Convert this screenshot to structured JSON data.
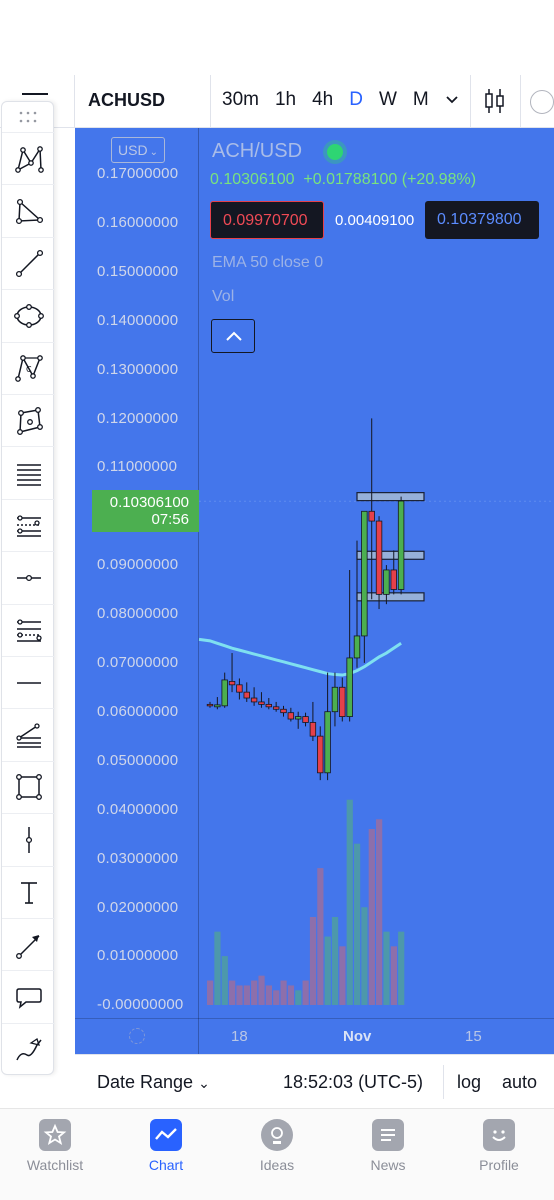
{
  "header": {
    "symbol": "ACHUSD",
    "intervals": [
      "30m",
      "1h",
      "4h",
      "D",
      "W",
      "M"
    ],
    "active_interval": "D"
  },
  "chart": {
    "currency": "USD",
    "title": "ACH/USD",
    "last": "0.10306100",
    "change": "+0.01788100",
    "change_pct": "(+20.98%)",
    "bid": "0.09970700",
    "spread": "0.00409100",
    "ask": "0.10379800",
    "ema_label": "EMA 50 close 0",
    "vol_label": "Vol",
    "price_tag": "0.10306100",
    "countdown": "07:56",
    "price_levels": [
      "0.17000000",
      "0.16000000",
      "0.15000000",
      "0.14000000",
      "0.13000000",
      "0.12000000",
      "0.11000000",
      "0.10000000",
      "0.09000000",
      "0.08000000",
      "0.07000000",
      "0.06000000",
      "0.05000000",
      "0.04000000",
      "0.03000000",
      "0.02000000",
      "0.01000000",
      "-0.00000000"
    ],
    "time_labels": [
      "18",
      "Nov",
      "15"
    ],
    "colors": {
      "background": "#4476eb",
      "up": "#4caf50",
      "down": "#e5404a",
      "ema": "#7fe0f0"
    }
  },
  "chart_data": {
    "type": "candlestick",
    "title": "ACH/USD",
    "ylim": [
      -0.005,
      0.175
    ],
    "candles": [
      {
        "o": 0.0615,
        "h": 0.062,
        "l": 0.0608,
        "c": 0.0612
      },
      {
        "o": 0.061,
        "h": 0.063,
        "l": 0.0605,
        "c": 0.0614
      },
      {
        "o": 0.0612,
        "h": 0.068,
        "l": 0.0608,
        "c": 0.0665
      },
      {
        "o": 0.0662,
        "h": 0.072,
        "l": 0.064,
        "c": 0.0655
      },
      {
        "o": 0.0655,
        "h": 0.0668,
        "l": 0.0625,
        "c": 0.064
      },
      {
        "o": 0.064,
        "h": 0.066,
        "l": 0.062,
        "c": 0.0628
      },
      {
        "o": 0.0628,
        "h": 0.065,
        "l": 0.0612,
        "c": 0.062
      },
      {
        "o": 0.062,
        "h": 0.064,
        "l": 0.0608,
        "c": 0.0615
      },
      {
        "o": 0.0615,
        "h": 0.0628,
        "l": 0.0605,
        "c": 0.061
      },
      {
        "o": 0.061,
        "h": 0.062,
        "l": 0.06,
        "c": 0.0605
      },
      {
        "o": 0.0605,
        "h": 0.0612,
        "l": 0.059,
        "c": 0.0598
      },
      {
        "o": 0.0598,
        "h": 0.0608,
        "l": 0.058,
        "c": 0.0585
      },
      {
        "o": 0.0585,
        "h": 0.06,
        "l": 0.0565,
        "c": 0.059
      },
      {
        "o": 0.059,
        "h": 0.0598,
        "l": 0.057,
        "c": 0.0578
      },
      {
        "o": 0.0578,
        "h": 0.062,
        "l": 0.054,
        "c": 0.055
      },
      {
        "o": 0.055,
        "h": 0.057,
        "l": 0.046,
        "c": 0.0475
      },
      {
        "o": 0.0475,
        "h": 0.068,
        "l": 0.046,
        "c": 0.06
      },
      {
        "o": 0.06,
        "h": 0.068,
        "l": 0.057,
        "c": 0.065
      },
      {
        "o": 0.065,
        "h": 0.067,
        "l": 0.058,
        "c": 0.059
      },
      {
        "o": 0.059,
        "h": 0.089,
        "l": 0.058,
        "c": 0.071
      },
      {
        "o": 0.071,
        "h": 0.095,
        "l": 0.069,
        "c": 0.0755
      },
      {
        "o": 0.0755,
        "h": 0.099,
        "l": 0.07,
        "c": 0.101
      },
      {
        "o": 0.101,
        "h": 0.12,
        "l": 0.083,
        "c": 0.099
      },
      {
        "o": 0.099,
        "h": 0.1,
        "l": 0.081,
        "c": 0.084
      },
      {
        "o": 0.084,
        "h": 0.09,
        "l": 0.082,
        "c": 0.089
      },
      {
        "o": 0.089,
        "h": 0.093,
        "l": 0.084,
        "c": 0.085
      },
      {
        "o": 0.085,
        "h": 0.104,
        "l": 0.084,
        "c": 0.1031
      }
    ],
    "volume": [
      0.005,
      0.015,
      0.01,
      0.005,
      0.004,
      0.004,
      0.005,
      0.006,
      0.004,
      0.003,
      0.005,
      0.004,
      0.003,
      0.005,
      0.018,
      0.028,
      0.014,
      0.018,
      0.012,
      0.042,
      0.033,
      0.02,
      0.036,
      0.038,
      0.015,
      0.012,
      0.015
    ],
    "ema": [
      0.0745,
      0.074,
      0.0735,
      0.073,
      0.0726,
      0.0722,
      0.0718,
      0.0714,
      0.071,
      0.0706,
      0.0702,
      0.0698,
      0.0694,
      0.069,
      0.0686,
      0.0682,
      0.0678,
      0.0676,
      0.0675,
      0.0678,
      0.0684,
      0.0692,
      0.0702,
      0.0712,
      0.072,
      0.073,
      0.074
    ],
    "levels": [
      0.104,
      0.092,
      0.0835
    ]
  },
  "toolbar": {
    "tools": [
      "xabcd-pattern-icon",
      "triangle-pattern-icon",
      "trend-line-icon",
      "ellipse-icon",
      "abcd-pattern-icon",
      "polygon-icon",
      "horizontal-lines-icon",
      "fib-channel-icon",
      "horizontal-ray-icon",
      "fib-retracement-icon",
      "horizontal-line-icon",
      "pitchfan-icon",
      "rectangle-icon",
      "vertical-line-icon",
      "text-icon",
      "arrow-icon",
      "callout-icon",
      "brush-icon"
    ]
  },
  "bottom": {
    "date_range": "Date Range",
    "clock": "18:52:03 (UTC-5)",
    "log": "log",
    "auto": "auto"
  },
  "tabs": [
    {
      "label": "Watchlist",
      "icon": "star-icon",
      "active": false
    },
    {
      "label": "Chart",
      "icon": "chart-icon",
      "active": true
    },
    {
      "label": "Ideas",
      "icon": "bulb-icon",
      "active": false
    },
    {
      "label": "News",
      "icon": "news-icon",
      "active": false
    },
    {
      "label": "Profile",
      "icon": "smile-icon",
      "active": false
    }
  ]
}
